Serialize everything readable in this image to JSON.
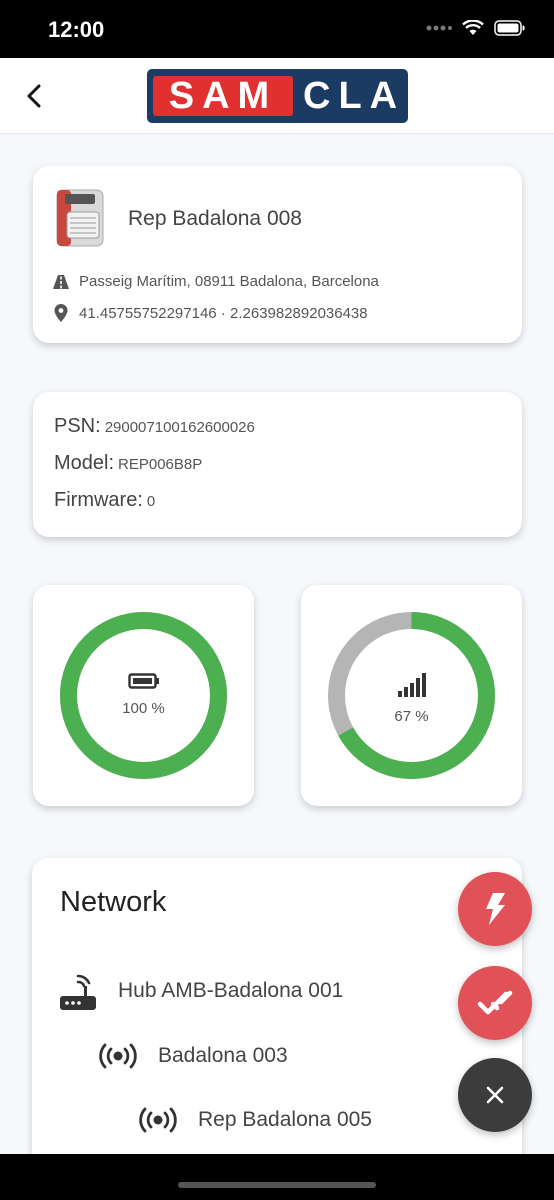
{
  "status_bar": {
    "time": "12:00"
  },
  "header": {
    "logo_red": "SAM",
    "logo_blue": "CLA"
  },
  "device": {
    "name": "Rep Badalona 008",
    "address": "Passeig Marítim, 08911 Badalona, Barcelona",
    "coordinates": "41.45755752297146 · 2.263982892036438"
  },
  "details": {
    "psn_label": "PSN:",
    "psn_value": "290007100162600026",
    "model_label": "Model:",
    "model_value": "REP006B8P",
    "firmware_label": "Firmware:",
    "firmware_value": "0"
  },
  "gauges": {
    "battery": {
      "label": "100 %",
      "value": 100,
      "icon": "battery-icon"
    },
    "signal": {
      "label": "67 %",
      "value": 67,
      "icon": "signal-bars-icon"
    }
  },
  "network": {
    "title": "Network",
    "items": [
      {
        "label": "Hub AMB-Badalona 001",
        "icon": "router-icon"
      },
      {
        "label": "Badalona 003",
        "icon": "broadcast-icon"
      },
      {
        "label": "Rep Badalona 005",
        "icon": "broadcast-icon"
      }
    ]
  },
  "fabs": {
    "bolt": "bolt-icon",
    "check": "double-check-icon",
    "close": "close-icon"
  },
  "colors": {
    "gauge_fill": "#4caf50",
    "gauge_empty": "#b5b5b5",
    "fab_red": "#e05258",
    "fab_dark": "#3c3c3c",
    "logo_navy": "#1c3b63",
    "logo_red": "#e0302f"
  }
}
